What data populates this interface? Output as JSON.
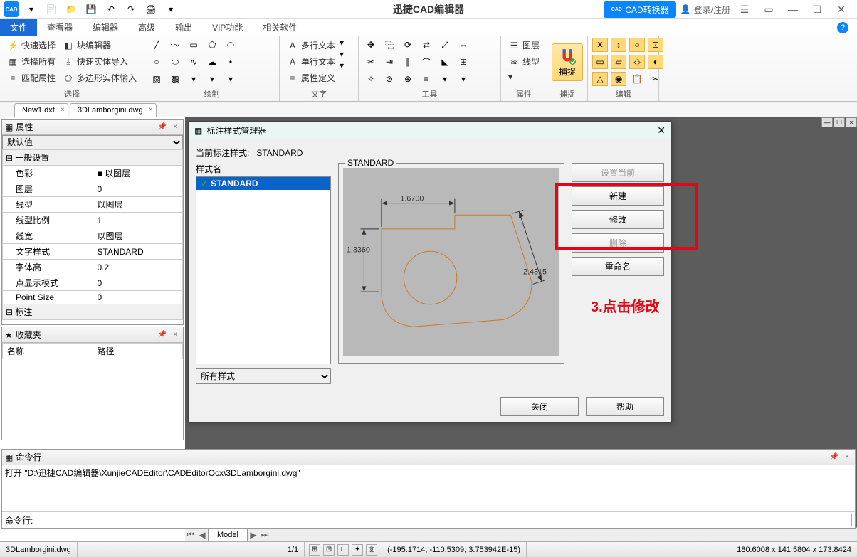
{
  "title": "迅捷CAD编辑器",
  "qat": {
    "logo": "CAD"
  },
  "titlebar_right": {
    "converter": "CAD转换器",
    "login": "登录/注册"
  },
  "ribbon_tabs": [
    "文件",
    "查看器",
    "编辑器",
    "高级",
    "输出",
    "VIP功能",
    "相关软件"
  ],
  "ribbon_active_index": 0,
  "ribbon": {
    "select": {
      "label": "选择",
      "items": [
        "快速选择",
        "块编辑器",
        "选择所有",
        "快速实体导入",
        "匹配属性",
        "多边形实体输入"
      ]
    },
    "draw": {
      "label": "绘制"
    },
    "text": {
      "label": "文字",
      "items": [
        "多行文本",
        "单行文本",
        "属性定义"
      ]
    },
    "tools": {
      "label": "工具"
    },
    "props": {
      "label": "属性",
      "items": [
        "图层",
        "线型"
      ]
    },
    "snap": {
      "label": "捕捉",
      "btn": "捕捉"
    },
    "edit": {
      "label": "编辑"
    }
  },
  "doc_tabs": [
    "New1.dxf",
    "3DLamborgini.dwg"
  ],
  "props_panel": {
    "title": "属性",
    "combo": "默认值",
    "sections": {
      "general": "一般设置",
      "dim": "标注"
    },
    "rows": [
      {
        "k": "色彩",
        "v": "■ 以图层"
      },
      {
        "k": "图层",
        "v": "0"
      },
      {
        "k": "线型",
        "v": "以图层"
      },
      {
        "k": "线型比例",
        "v": "1"
      },
      {
        "k": "线宽",
        "v": "以图层"
      },
      {
        "k": "文字样式",
        "v": "STANDARD"
      },
      {
        "k": "字体高",
        "v": "0.2"
      },
      {
        "k": "点显示模式",
        "v": "0"
      },
      {
        "k": "Point Size",
        "v": "0"
      }
    ]
  },
  "fav_panel": {
    "title": "收藏夹",
    "cols": [
      "名称",
      "路径"
    ]
  },
  "dialog": {
    "title": "标注样式管理器",
    "current_label": "当前标注样式:",
    "current_value": "STANDARD",
    "list_label": "样式名",
    "styles": [
      "STANDARD"
    ],
    "filter": "所有样式",
    "preview_legend": "STANDARD",
    "dims": {
      "top": "1.6700",
      "left": "1.3360",
      "right": "2.4315"
    },
    "buttons": {
      "set_current": "设置当前",
      "new": "新建",
      "modify": "修改",
      "delete": "删除",
      "rename": "重命名",
      "close": "关闭",
      "help": "帮助"
    }
  },
  "annotation": "3.点击修改",
  "cmd_panel": {
    "title": "命令行",
    "log": "打开 \"D:\\迅捷CAD编辑器\\XunjieCADEditor\\CADEditorOcx\\3DLamborgini.dwg\"",
    "prompt": "命令行:"
  },
  "model_tab": "Model",
  "status": {
    "file": "3DLamborgini.dwg",
    "page": "1/1",
    "coords": "(-195.1714; -110.5309; 3.753942E-15)",
    "dims": "180.6008 x 141.5804 x 173.8424"
  }
}
